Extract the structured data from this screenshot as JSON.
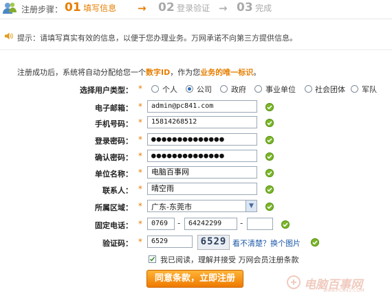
{
  "steps": {
    "label": "注册步骤：",
    "items": [
      {
        "num": "01",
        "text": "填写信息",
        "active": true
      },
      {
        "num": "02",
        "text": "登录验证",
        "active": false
      },
      {
        "num": "03",
        "text": "完成",
        "active": false
      }
    ]
  },
  "tip": {
    "text": "提示：请填写真实有效的信息，以便于您办理业务。万网承诺不向第三方提供信息。"
  },
  "intro": {
    "prefix": "注册成功后，系统将自动分配给您一个",
    "highlight1": "数字ID",
    "middle": "，作为您",
    "highlight2": "业务的唯一标识",
    "suffix": "。"
  },
  "form": {
    "user_type": {
      "label": "选择用户类型：",
      "options": [
        "个人",
        "公司",
        "政府",
        "事业单位",
        "社会团体",
        "军队"
      ],
      "selected": "公司"
    },
    "email": {
      "label": "电子邮箱：",
      "value": "admin@pc841.com"
    },
    "mobile": {
      "label": "手机号码：",
      "value": "15814268512"
    },
    "password": {
      "label": "登录密码：",
      "value": "●●●●●●●●●●●●●●"
    },
    "confirm_password": {
      "label": "确认密码：",
      "value": "●●●●●●●●●●●●●●"
    },
    "company": {
      "label": "单位名称：",
      "value": "电脑百事网"
    },
    "contact": {
      "label": "联系人：",
      "value": "晴空雨"
    },
    "region": {
      "label": "所属区域：",
      "value": "广东-东莞市"
    },
    "phone": {
      "label": "固定电话：",
      "area": "0769",
      "number": "64242299",
      "ext": ""
    },
    "captcha": {
      "label": "验证码：",
      "value": "6529",
      "image_text": "6529",
      "refresh_link": "看不清楚？换个图片"
    },
    "agree": {
      "checked": true,
      "text": "我已阅读，理解并接受 万网会员注册条款"
    },
    "required_mark": "*"
  },
  "submit": {
    "label": "同意条款，立即注册"
  },
  "watermark": {
    "text": "电脑百事网",
    "url": "www.PC841.COM"
  },
  "colors": {
    "accent": "#e67e00",
    "check": "#7ab72a",
    "link": "#1a57a8"
  },
  "icons": {
    "logo": "users-icon",
    "tip": "speaker-icon",
    "valid": "check-icon",
    "dropdown": "chevron-down-icon"
  }
}
